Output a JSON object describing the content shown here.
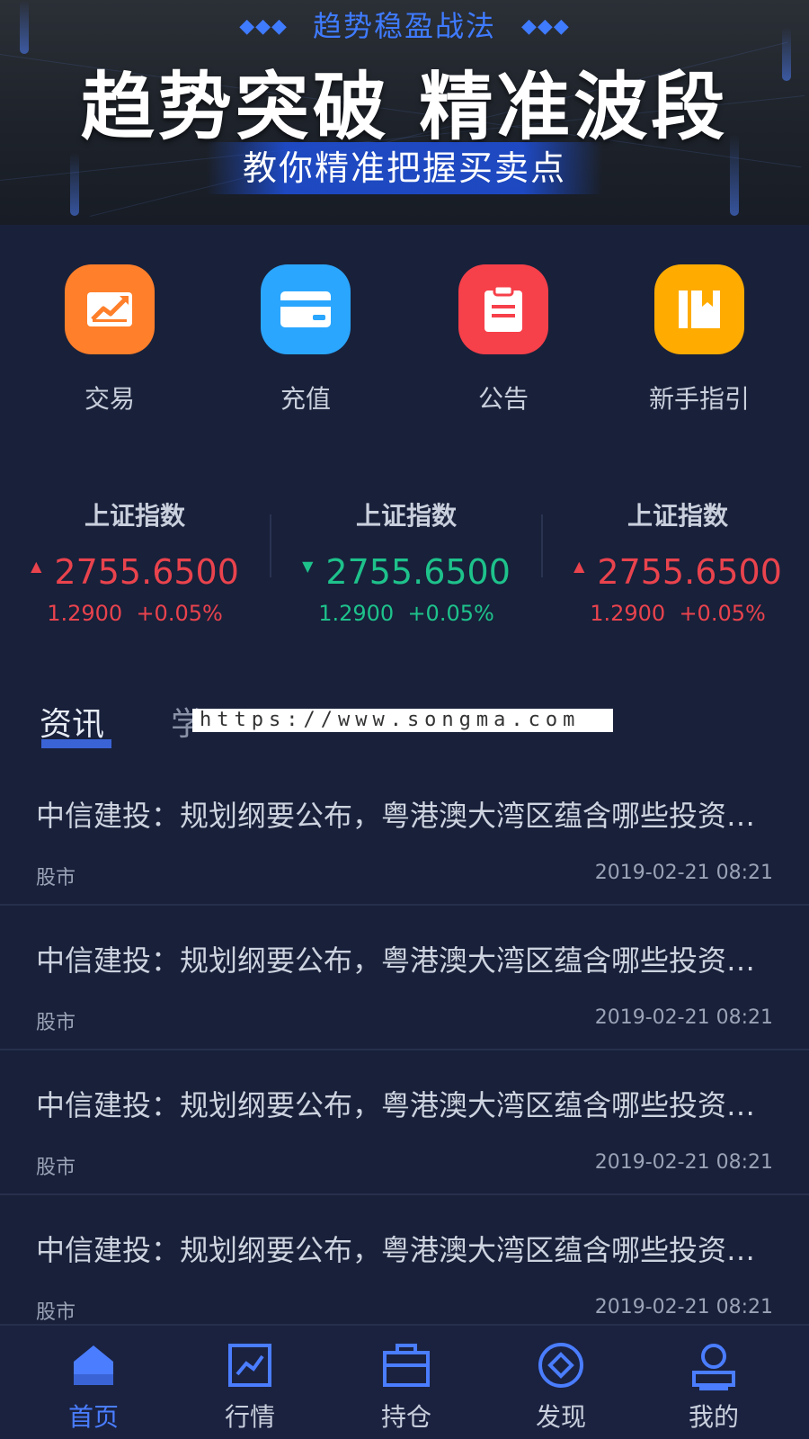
{
  "banner": {
    "subtitle": "趋势稳盈战法",
    "dots": "◆◆◆",
    "title": "趋势突破 精准波段",
    "tagline": "教你精准把握买卖点"
  },
  "quick_menu": [
    {
      "label": "交易",
      "icon": "trend-chart-icon",
      "color": "#ff7f2a"
    },
    {
      "label": "充值",
      "icon": "card-icon",
      "color": "#2aa6ff"
    },
    {
      "label": "公告",
      "icon": "clipboard-icon",
      "color": "#f6404a"
    },
    {
      "label": "新手指引",
      "icon": "book-icon",
      "color": "#ffab00"
    }
  ],
  "indices": [
    {
      "name": "上证指数",
      "value": "2755.6500",
      "change": "1.2900",
      "percent": "+0.05%",
      "trend": "up"
    },
    {
      "name": "上证指数",
      "value": "2755.6500",
      "change": "1.2900",
      "percent": "+0.05%",
      "trend": "down"
    },
    {
      "name": "上证指数",
      "value": "2755.6500",
      "change": "1.2900",
      "percent": "+0.05%",
      "trend": "up"
    }
  ],
  "tabs": {
    "active": "资讯",
    "second": "学"
  },
  "watermark": "https://www.songma.com",
  "news": [
    {
      "title": "中信建投：规划纲要公布，粤港澳大湾区蕴含哪些投资…",
      "category": "股市",
      "time": "2019-02-21 08:21"
    },
    {
      "title": "中信建投：规划纲要公布，粤港澳大湾区蕴含哪些投资…",
      "category": "股市",
      "time": "2019-02-21 08:21"
    },
    {
      "title": "中信建投：规划纲要公布，粤港澳大湾区蕴含哪些投资…",
      "category": "股市",
      "time": "2019-02-21 08:21"
    },
    {
      "title": "中信建投：规划纲要公布，粤港澳大湾区蕴含哪些投资…",
      "category": "股市",
      "time": "2019-02-21 08:21"
    }
  ],
  "bottom_nav": [
    {
      "label": "首页",
      "icon": "home-icon",
      "active": true
    },
    {
      "label": "行情",
      "icon": "chart-icon",
      "active": false
    },
    {
      "label": "持仓",
      "icon": "briefcase-icon",
      "active": false
    },
    {
      "label": "发现",
      "icon": "compass-icon",
      "active": false
    },
    {
      "label": "我的",
      "icon": "user-icon",
      "active": false
    }
  ],
  "colors": {
    "accent": "#4a7dff",
    "up": "#e9434d",
    "down": "#1ec28b",
    "background": "#18203a"
  }
}
